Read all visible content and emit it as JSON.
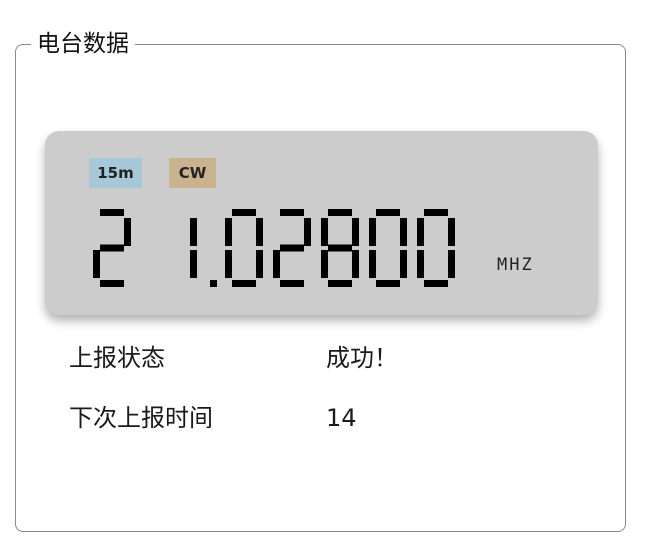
{
  "group_title": "电台数据",
  "lcd": {
    "band": "15m",
    "mode": "CW",
    "frequency": "21.02800",
    "unit": "MHZ",
    "band_color": "#a6c8d8",
    "mode_color": "#c9b38e",
    "background_color": "#cccccc"
  },
  "report": {
    "status_label": "上报状态",
    "status_value": "成功！",
    "next_label": "下次上报时间",
    "next_value": "14"
  }
}
